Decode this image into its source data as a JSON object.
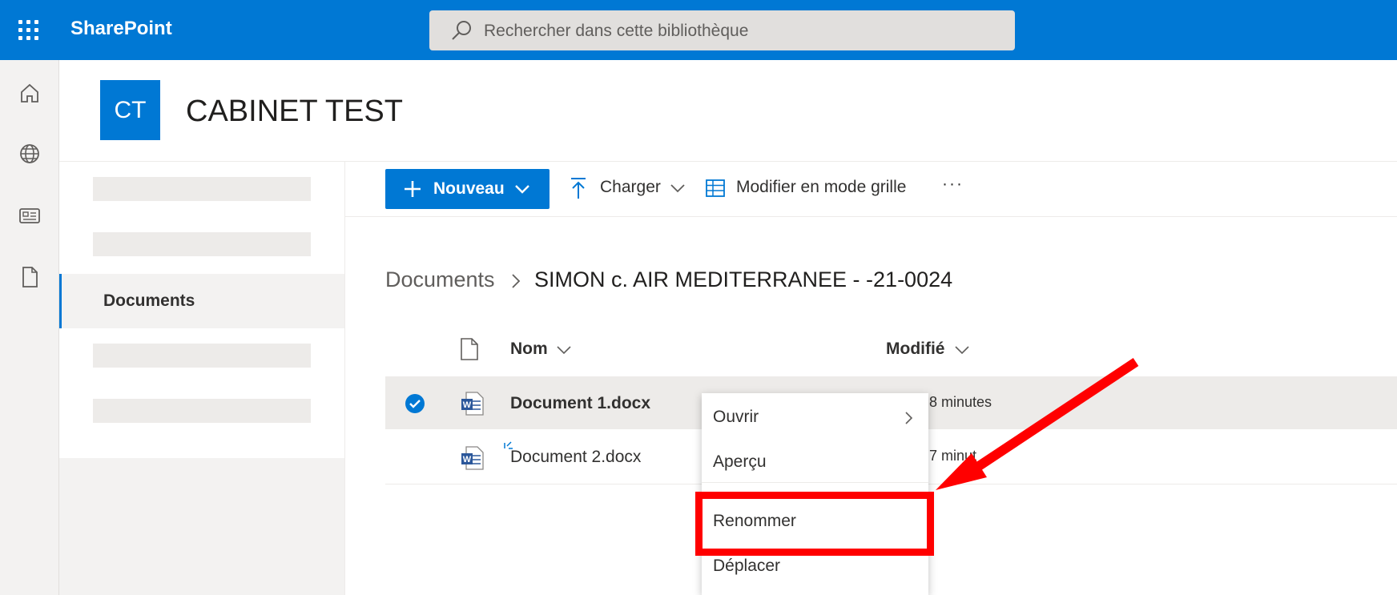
{
  "topbar": {
    "app_name": "SharePoint",
    "search_placeholder": "Rechercher dans cette bibliothèque",
    "color": "#0078d4"
  },
  "rail": {
    "icons": [
      "home-icon",
      "globe-icon",
      "news-icon",
      "file-icon"
    ]
  },
  "site": {
    "logo_text": "CT",
    "title": "CABINET TEST"
  },
  "leftnav": {
    "active_item": "Documents"
  },
  "commandbar": {
    "new_label": "Nouveau",
    "upload_label": "Charger",
    "grid_label": "Modifier en mode grille",
    "more_label": "···"
  },
  "breadcrumb": {
    "root": "Documents",
    "separator": ">",
    "current": "SIMON c. AIR MEDITERRANEE - -21-0024"
  },
  "list": {
    "columns": {
      "name": "Nom",
      "modified": "Modifié"
    },
    "rows": [
      {
        "name": "Document 1.docx",
        "modified_visible": "8 minutes",
        "selected": true
      },
      {
        "name": "Document 2.docx",
        "modified_visible": "7 minut",
        "selected": false
      }
    ]
  },
  "context_menu": {
    "items": [
      "Ouvrir",
      "Aperçu",
      "Renommer",
      "Déplacer"
    ]
  },
  "annotation": {
    "color": "#ff0000",
    "highlighted_item": "Renommer"
  }
}
